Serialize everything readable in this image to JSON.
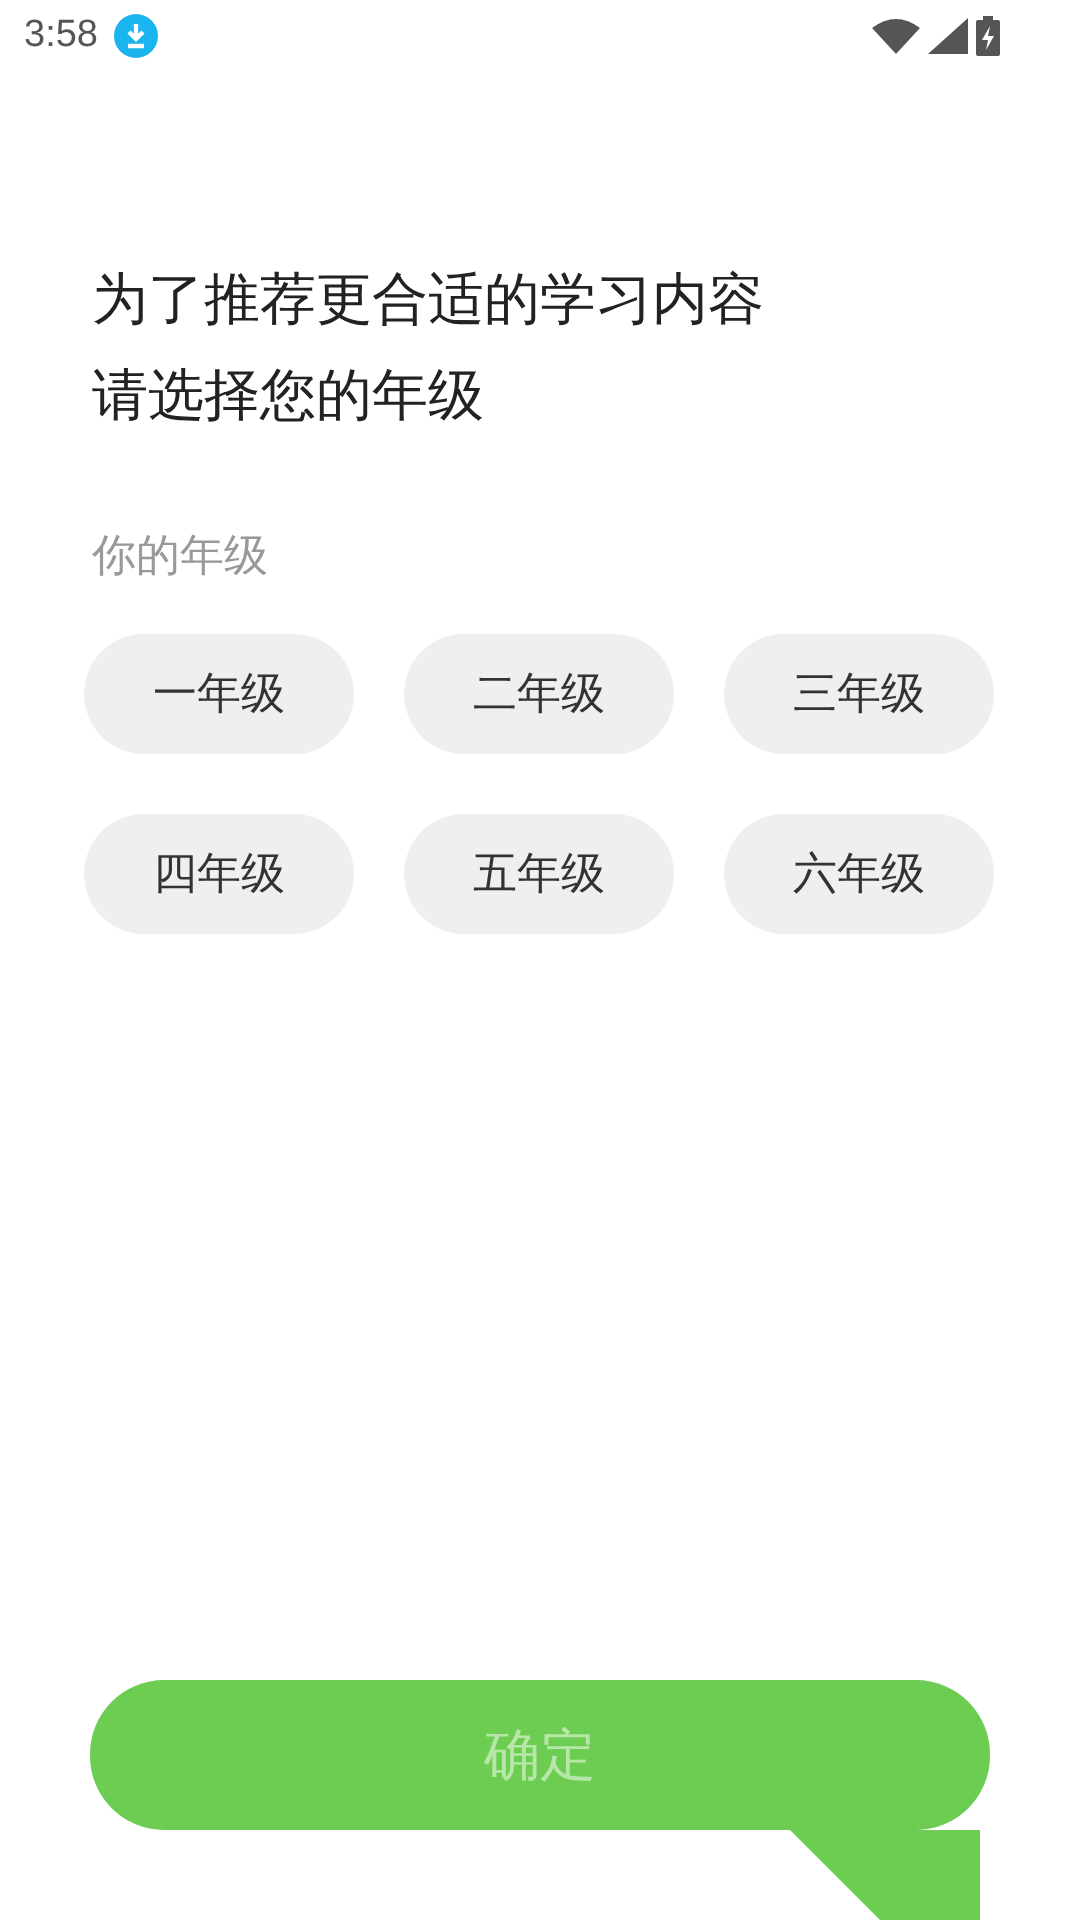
{
  "status_bar": {
    "time": "3:58"
  },
  "title_lines": [
    "为了推荐更合适的学习内容",
    "请选择您的年级"
  ],
  "section_label": "你的年级",
  "grades": [
    {
      "label": "一年级",
      "selected": false
    },
    {
      "label": "二年级",
      "selected": false
    },
    {
      "label": "三年级",
      "selected": false
    },
    {
      "label": "四年级",
      "selected": false
    },
    {
      "label": "五年级",
      "selected": false
    },
    {
      "label": "六年级",
      "selected": false
    }
  ],
  "confirm_button": {
    "label": "确定",
    "disabled": true
  }
}
